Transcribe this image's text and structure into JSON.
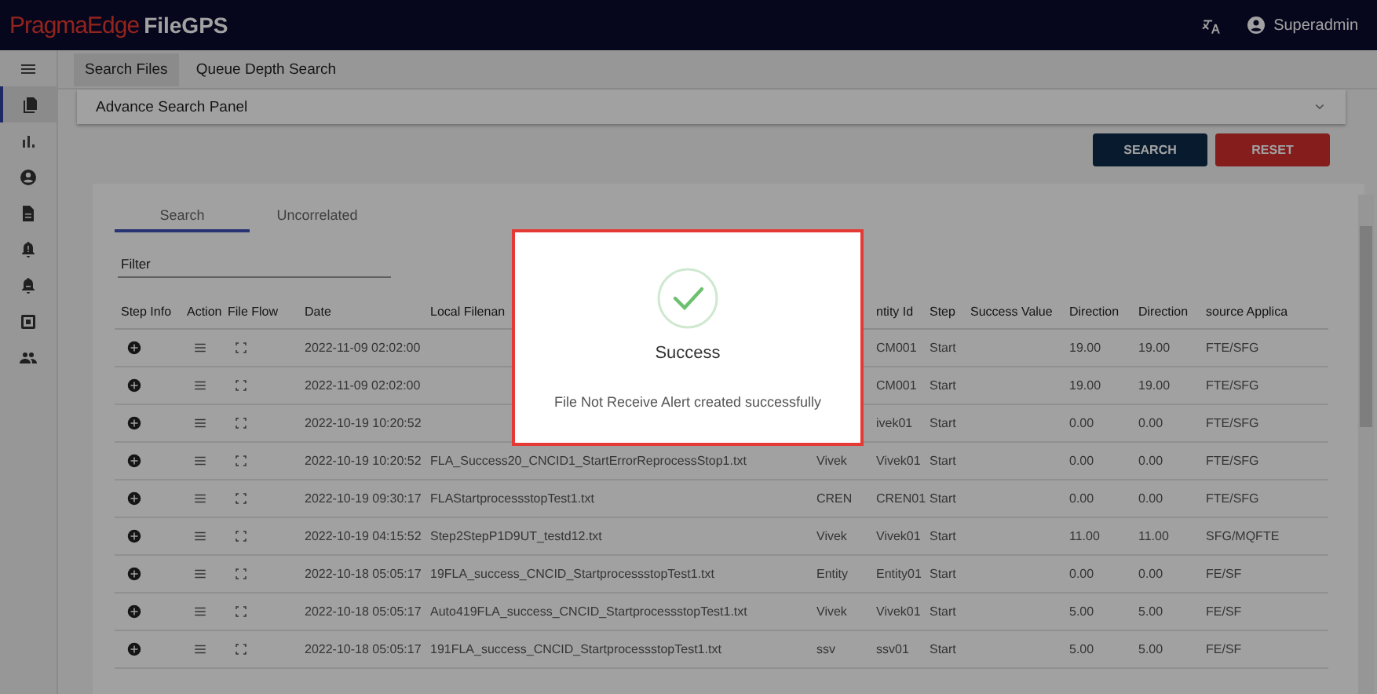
{
  "app_bar": {
    "brand": "PragmaEdge",
    "product": "FileGPS",
    "user": "Superadmin"
  },
  "sidebar": {
    "items": [
      {
        "kind": "menu",
        "selected": false
      },
      {
        "kind": "files",
        "selected": true
      },
      {
        "kind": "chart",
        "selected": false
      },
      {
        "kind": "account",
        "selected": false
      },
      {
        "kind": "document",
        "selected": false
      },
      {
        "kind": "alert",
        "selected": false
      },
      {
        "kind": "bell",
        "selected": false
      },
      {
        "kind": "box",
        "selected": false
      },
      {
        "kind": "group",
        "selected": false
      }
    ]
  },
  "nav_tabs": [
    {
      "label": "Search Files",
      "selected": true
    },
    {
      "label": "Queue Depth Search",
      "selected": false
    }
  ],
  "advance_panel": {
    "title": "Advance Search Panel",
    "expanded": false
  },
  "buttons": [
    {
      "label": "SEARCH",
      "kind": "primary"
    },
    {
      "label": "RESET",
      "kind": "danger"
    }
  ],
  "result_tabs": [
    {
      "label": "Search",
      "selected": true
    },
    {
      "label": "Uncorrelated",
      "selected": false
    }
  ],
  "filter": {
    "placeholder": "Filter"
  },
  "table": {
    "columns": [
      "Step Info",
      "Action",
      "File Flow",
      "Date",
      "Local Filenan",
      "",
      "ntity Id",
      "Step",
      "Success Value",
      "Direction",
      "Direction",
      "source Applica"
    ],
    "rows": [
      {
        "date": "2022-11-09 02:02:00",
        "entity_id": "CM001",
        "step": "Start",
        "direction_1": "19.00",
        "direction_2": "19.00",
        "source_application": "FTE/SFG"
      },
      {
        "date": "2022-11-09 02:02:00",
        "entity_id": "CM001",
        "step": "Start",
        "direction_1": "19.00",
        "direction_2": "19.00",
        "source_application": "FTE/SFG"
      },
      {
        "date": "2022-10-19 10:20:52",
        "entity_id": "ivek01",
        "step": "Start",
        "direction_1": "0.00",
        "direction_2": "0.00",
        "source_application": "FTE/SFG"
      },
      {
        "date": "2022-10-19 10:20:52",
        "local_filename": "FLA_Success20_CNCID1_StartErrorReprocessStop1.txt",
        "column_6": "Vivek",
        "entity_id": "Vivek01",
        "step": "Start",
        "direction_1": "0.00",
        "direction_2": "0.00",
        "source_application": "FTE/SFG"
      },
      {
        "date": "2022-10-19 09:30:17",
        "local_filename": "FLAStartprocessstopTest1.txt",
        "column_6": "CREN",
        "entity_id": "CREN01",
        "step": "Start",
        "direction_1": "0.00",
        "direction_2": "0.00",
        "source_application": "FTE/SFG"
      },
      {
        "date": "2022-10-19 04:15:52",
        "local_filename": "Step2StepP1D9UT_testd12.txt",
        "column_6": "Vivek",
        "entity_id": "Vivek01",
        "step": "Start",
        "direction_1": "11.00",
        "direction_2": "11.00",
        "source_application": "SFG/MQFTE"
      },
      {
        "date": "2022-10-18 05:05:17",
        "local_filename": "19FLA_success_CNCID_StartprocessstopTest1.txt",
        "column_6": "Entity",
        "entity_id": "Entity01",
        "step": "Start",
        "direction_1": "0.00",
        "direction_2": "0.00",
        "source_application": "FE/SF"
      },
      {
        "date": "2022-10-18 05:05:17",
        "local_filename": "Auto419FLA_success_CNCID_StartprocessstopTest1.txt",
        "column_6": "Vivek",
        "entity_id": "Vivek01",
        "step": "Start",
        "direction_1": "5.00",
        "direction_2": "5.00",
        "source_application": "FE/SF"
      },
      {
        "date": "2022-10-18 05:05:17",
        "local_filename": "191FLA_success_CNCID_StartprocessstopTest1.txt",
        "column_6": "ssv",
        "entity_id": "ssv01",
        "step": "Start",
        "direction_1": "5.00",
        "direction_2": "5.00",
        "source_application": "FE/SF"
      }
    ]
  },
  "dialog": {
    "title": "Success",
    "message": "File Not Receive Alert created successfully"
  }
}
